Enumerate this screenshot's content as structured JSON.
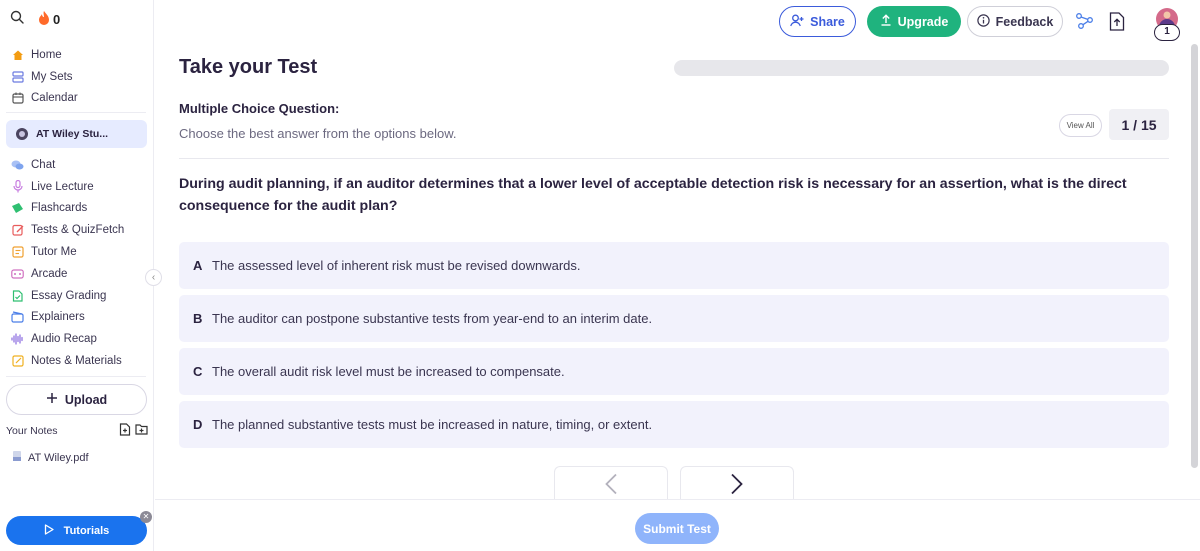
{
  "streak": {
    "count": "0"
  },
  "sidebar": {
    "nav_top": [
      {
        "label": "Home",
        "icon": "home-icon"
      },
      {
        "label": "My Sets",
        "icon": "sets-icon"
      },
      {
        "label": "Calendar",
        "icon": "calendar-icon"
      }
    ],
    "workspace": "AT Wiley Stu...",
    "nav_tools": [
      {
        "label": "Chat",
        "icon": "chat-icon"
      },
      {
        "label": "Live Lecture",
        "icon": "microphone-icon"
      },
      {
        "label": "Flashcards",
        "icon": "flashcards-icon"
      },
      {
        "label": "Tests & QuizFetch",
        "icon": "test-icon"
      },
      {
        "label": "Tutor Me",
        "icon": "tutor-icon"
      },
      {
        "label": "Arcade",
        "icon": "arcade-icon"
      },
      {
        "label": "Essay Grading",
        "icon": "essay-icon"
      },
      {
        "label": "Explainers",
        "icon": "explainers-icon"
      },
      {
        "label": "Audio Recap",
        "icon": "audio-icon"
      },
      {
        "label": "Notes & Materials",
        "icon": "notes-icon"
      }
    ],
    "upload_label": "Upload",
    "your_notes_label": "Your Notes",
    "notes": [
      {
        "label": "AT Wiley.pdf"
      }
    ],
    "tutorials_label": "Tutorials"
  },
  "header": {
    "share_label": "Share",
    "upgrade_label": "Upgrade",
    "feedback_label": "Feedback",
    "avatar_badge": "1"
  },
  "test": {
    "title": "Take your Test",
    "progress_fraction": 0,
    "question_type": "Multiple Choice Question:",
    "instruction": "Choose the best answer from the options below.",
    "view_all_label": "View All",
    "counter": "1 / 15",
    "question": "During audit planning, if an auditor determines that a lower level of acceptable detection risk is necessary for an assertion, what is the direct consequence for the audit plan?",
    "options": [
      {
        "letter": "A",
        "text": "The assessed level of inherent risk must be revised downwards."
      },
      {
        "letter": "B",
        "text": "The auditor can postpone substantive tests from year-end to an interim date."
      },
      {
        "letter": "C",
        "text": "The overall audit risk level must be increased to compensate."
      },
      {
        "letter": "D",
        "text": "The planned substantive tests must be increased in nature, timing, or extent."
      }
    ],
    "submit_label": "Submit Test"
  },
  "colors": {
    "accent_blue": "#3b5bdb",
    "upgrade_green": "#1fb37e",
    "option_bg": "#f2f2fc",
    "workspace_bg": "#e6ebff",
    "tutorials_blue": "#1a73ee",
    "submit_disabled": "#8fb4fb"
  }
}
